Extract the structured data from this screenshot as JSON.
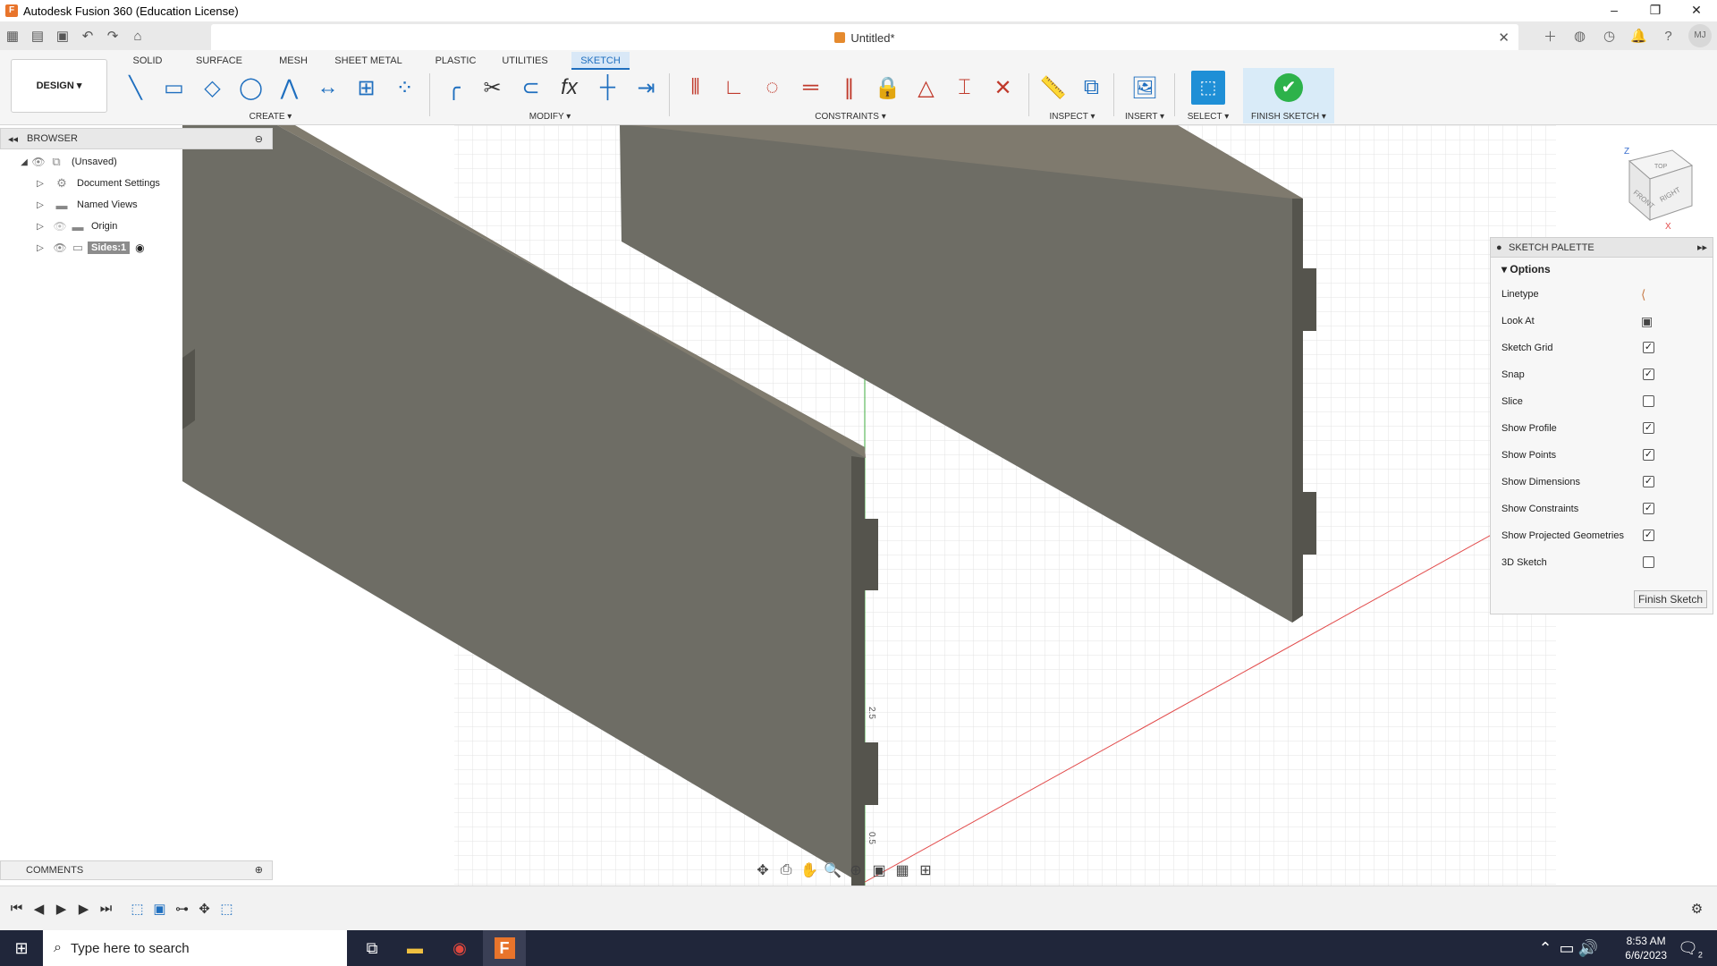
{
  "window": {
    "title": "Autodesk Fusion 360 (Education License)"
  },
  "tabbar": {
    "document_title": "Untitled*",
    "avatar_initials": "MJ"
  },
  "workspace": {
    "mode_label": "DESIGN",
    "tabs": [
      "SOLID",
      "SURFACE",
      "MESH",
      "SHEET METAL",
      "PLASTIC",
      "UTILITIES",
      "SKETCH"
    ],
    "active_tab": "SKETCH"
  },
  "toolbar": {
    "groups": {
      "create": "CREATE",
      "modify": "MODIFY",
      "constraints": "CONSTRAINTS",
      "inspect": "INSPECT",
      "insert": "INSERT",
      "select": "SELECT",
      "finish": "FINISH SKETCH"
    }
  },
  "browser": {
    "header": "BROWSER",
    "items": [
      {
        "label": "(Unsaved)"
      },
      {
        "label": "Document Settings"
      },
      {
        "label": "Named Views"
      },
      {
        "label": "Origin"
      },
      {
        "label": "Sides:1"
      }
    ]
  },
  "comments": {
    "label": "COMMENTS"
  },
  "viewcube": {
    "top": "TOP",
    "front": "FRONT",
    "right": "RIGHT",
    "z": "Z",
    "x": "X"
  },
  "canvas": {
    "dim_1": "2.5",
    "dim_2": "0.5"
  },
  "palette": {
    "header": "SKETCH PALETTE",
    "section": "Options",
    "options": [
      {
        "label": "Linetype",
        "type": "icon"
      },
      {
        "label": "Look At",
        "type": "icon"
      },
      {
        "label": "Sketch Grid",
        "type": "checkbox",
        "checked": true
      },
      {
        "label": "Snap",
        "type": "checkbox",
        "checked": true
      },
      {
        "label": "Slice",
        "type": "checkbox",
        "checked": false
      },
      {
        "label": "Show Profile",
        "type": "checkbox",
        "checked": true
      },
      {
        "label": "Show Points",
        "type": "checkbox",
        "checked": true
      },
      {
        "label": "Show Dimensions",
        "type": "checkbox",
        "checked": true
      },
      {
        "label": "Show Constraints",
        "type": "checkbox",
        "checked": true
      },
      {
        "label": "Show Projected Geometries",
        "type": "checkbox",
        "checked": true
      },
      {
        "label": "3D Sketch",
        "type": "checkbox",
        "checked": false
      }
    ],
    "finish_button": "Finish Sketch"
  },
  "taskbar": {
    "search_placeholder": "Type here to search",
    "time": "8:53 AM",
    "date": "6/6/2023",
    "notification_count": "2"
  },
  "colors": {
    "accent": "#1f6fbf",
    "finish_green": "#2db24a",
    "panel_body": "#6e6d65",
    "axis_green": "#3fae3f",
    "axis_red": "#e24b4b",
    "taskbar": "#20263a"
  }
}
